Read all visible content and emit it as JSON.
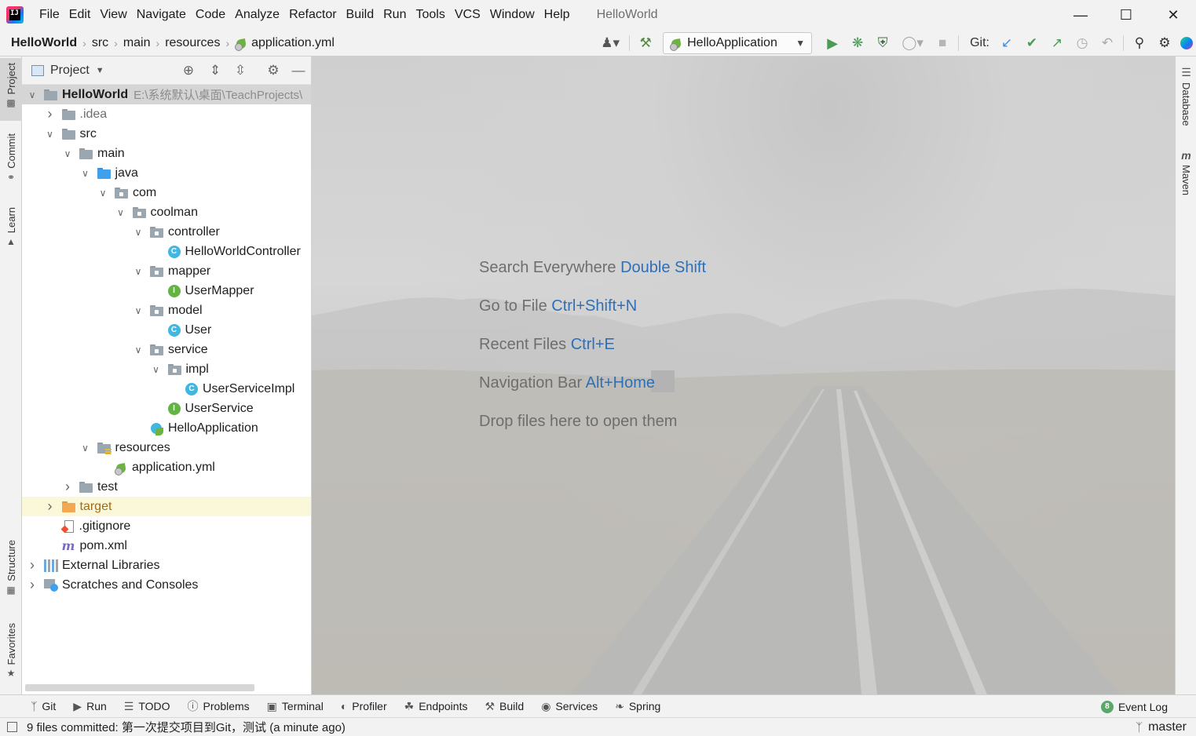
{
  "window": {
    "title": "HelloWorld",
    "menu": [
      "File",
      "Edit",
      "View",
      "Navigate",
      "Code",
      "Analyze",
      "Refactor",
      "Build",
      "Run",
      "Tools",
      "VCS",
      "Window",
      "Help"
    ]
  },
  "navbar": {
    "breadcrumb": [
      "HelloWorld",
      "src",
      "main",
      "resources",
      "application.yml"
    ],
    "run_config": "HelloApplication",
    "git_label": "Git:"
  },
  "left_strip": {
    "tabs": [
      "Project",
      "Commit",
      "Learn",
      "Structure",
      "Favorites"
    ]
  },
  "right_strip": {
    "tabs": [
      "Database",
      "Maven"
    ]
  },
  "project_panel": {
    "title": "Project",
    "tree": [
      {
        "label": "HelloWorld",
        "path": "E:\\系统默认\\桌面\\TeachProjects\\",
        "icon": "module-folder-icon",
        "expanded": true
      },
      {
        "label": ".idea",
        "icon": "folder-icon",
        "expanded": false
      },
      {
        "label": "src",
        "icon": "folder-icon",
        "expanded": true
      },
      {
        "label": "main",
        "icon": "folder-icon",
        "expanded": true
      },
      {
        "label": "java",
        "icon": "source-folder-icon",
        "expanded": true
      },
      {
        "label": "com",
        "icon": "package-icon",
        "expanded": true
      },
      {
        "label": "coolman",
        "icon": "package-icon",
        "expanded": true
      },
      {
        "label": "controller",
        "icon": "package-icon",
        "expanded": true
      },
      {
        "label": "HelloWorldController",
        "icon": "class-icon"
      },
      {
        "label": "mapper",
        "icon": "package-icon",
        "expanded": true
      },
      {
        "label": "UserMapper",
        "icon": "interface-icon"
      },
      {
        "label": "model",
        "icon": "package-icon",
        "expanded": true
      },
      {
        "label": "User",
        "icon": "class-icon"
      },
      {
        "label": "service",
        "icon": "package-icon",
        "expanded": true
      },
      {
        "label": "impl",
        "icon": "package-icon",
        "expanded": true
      },
      {
        "label": "UserServiceImpl",
        "icon": "class-icon"
      },
      {
        "label": "UserService",
        "icon": "interface-icon"
      },
      {
        "label": "HelloApplication",
        "icon": "spring-boot-class-icon"
      },
      {
        "label": "resources",
        "icon": "resources-folder-icon",
        "expanded": true
      },
      {
        "label": "application.yml",
        "icon": "spring-yml-icon"
      },
      {
        "label": "test",
        "icon": "folder-icon",
        "expanded": false
      },
      {
        "label": "target",
        "icon": "excluded-folder-icon",
        "expanded": false
      },
      {
        "label": ".gitignore",
        "icon": "gitignore-icon"
      },
      {
        "label": "pom.xml",
        "icon": "maven-icon"
      },
      {
        "label": "External Libraries",
        "icon": "libraries-icon",
        "expanded": false
      },
      {
        "label": "Scratches and Consoles",
        "icon": "scratches-icon",
        "expanded": false
      }
    ]
  },
  "editor": {
    "hints": [
      {
        "text": "Search Everywhere",
        "key": "Double Shift"
      },
      {
        "text": "Go to File",
        "key": "Ctrl+Shift+N"
      },
      {
        "text": "Recent Files",
        "key": "Ctrl+E"
      },
      {
        "text": "Navigation Bar",
        "key": "Alt+Home"
      },
      {
        "text": "Drop files here to open them",
        "key": ""
      }
    ]
  },
  "bottom_bar": {
    "tabs": [
      {
        "label": "Git",
        "icon": "git-branch-icon"
      },
      {
        "label": "Run",
        "icon": "run-icon"
      },
      {
        "label": "TODO",
        "icon": "todo-list-icon"
      },
      {
        "label": "Problems",
        "icon": "problems-icon"
      },
      {
        "label": "Terminal",
        "icon": "terminal-icon"
      },
      {
        "label": "Profiler",
        "icon": "profiler-icon"
      },
      {
        "label": "Endpoints",
        "icon": "endpoints-icon"
      },
      {
        "label": "Build",
        "icon": "hammer-icon"
      },
      {
        "label": "Services",
        "icon": "services-icon"
      },
      {
        "label": "Spring",
        "icon": "spring-leaf-icon"
      }
    ],
    "event_log": {
      "label": "Event Log",
      "count": "8"
    }
  },
  "status_bar": {
    "message": "9 files committed: 第一次提交项目到Git，测试 (a minute ago)",
    "branch": "master"
  },
  "colors": {
    "accent_key": "#2e6fb6",
    "run_green": "#59a869",
    "selection": "#d5d5d5"
  }
}
